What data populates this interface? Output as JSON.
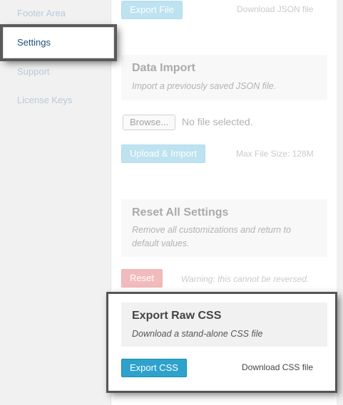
{
  "sidebar": {
    "items": [
      {
        "label": "Footer Area"
      },
      {
        "label": "Settings"
      },
      {
        "label": "Support"
      },
      {
        "label": "License Keys"
      }
    ]
  },
  "export_file": {
    "button_label": "Export File",
    "note": "Download JSON file"
  },
  "data_import": {
    "title": "Data Import",
    "description": "Import a previously saved JSON file.",
    "browse_label": "Browse...",
    "file_status": "No file selected.",
    "upload_label": "Upload & Import",
    "max_size_note": "Max File Size: 128M"
  },
  "reset_settings": {
    "title": "Reset All Settings",
    "description_line1": "Remove all customizations and return to",
    "description_line2": "default values.",
    "button_label": "Reset",
    "warning": "Warning: this cannot be reversed."
  },
  "export_css": {
    "title": "Export Raw CSS",
    "description": "Download a stand-alone CSS file",
    "button_label": "Export CSS",
    "note": "Download CSS file"
  },
  "colors": {
    "accent": "#2ea2cc",
    "danger": "#e46b6b",
    "active_text": "#1e4f79"
  }
}
